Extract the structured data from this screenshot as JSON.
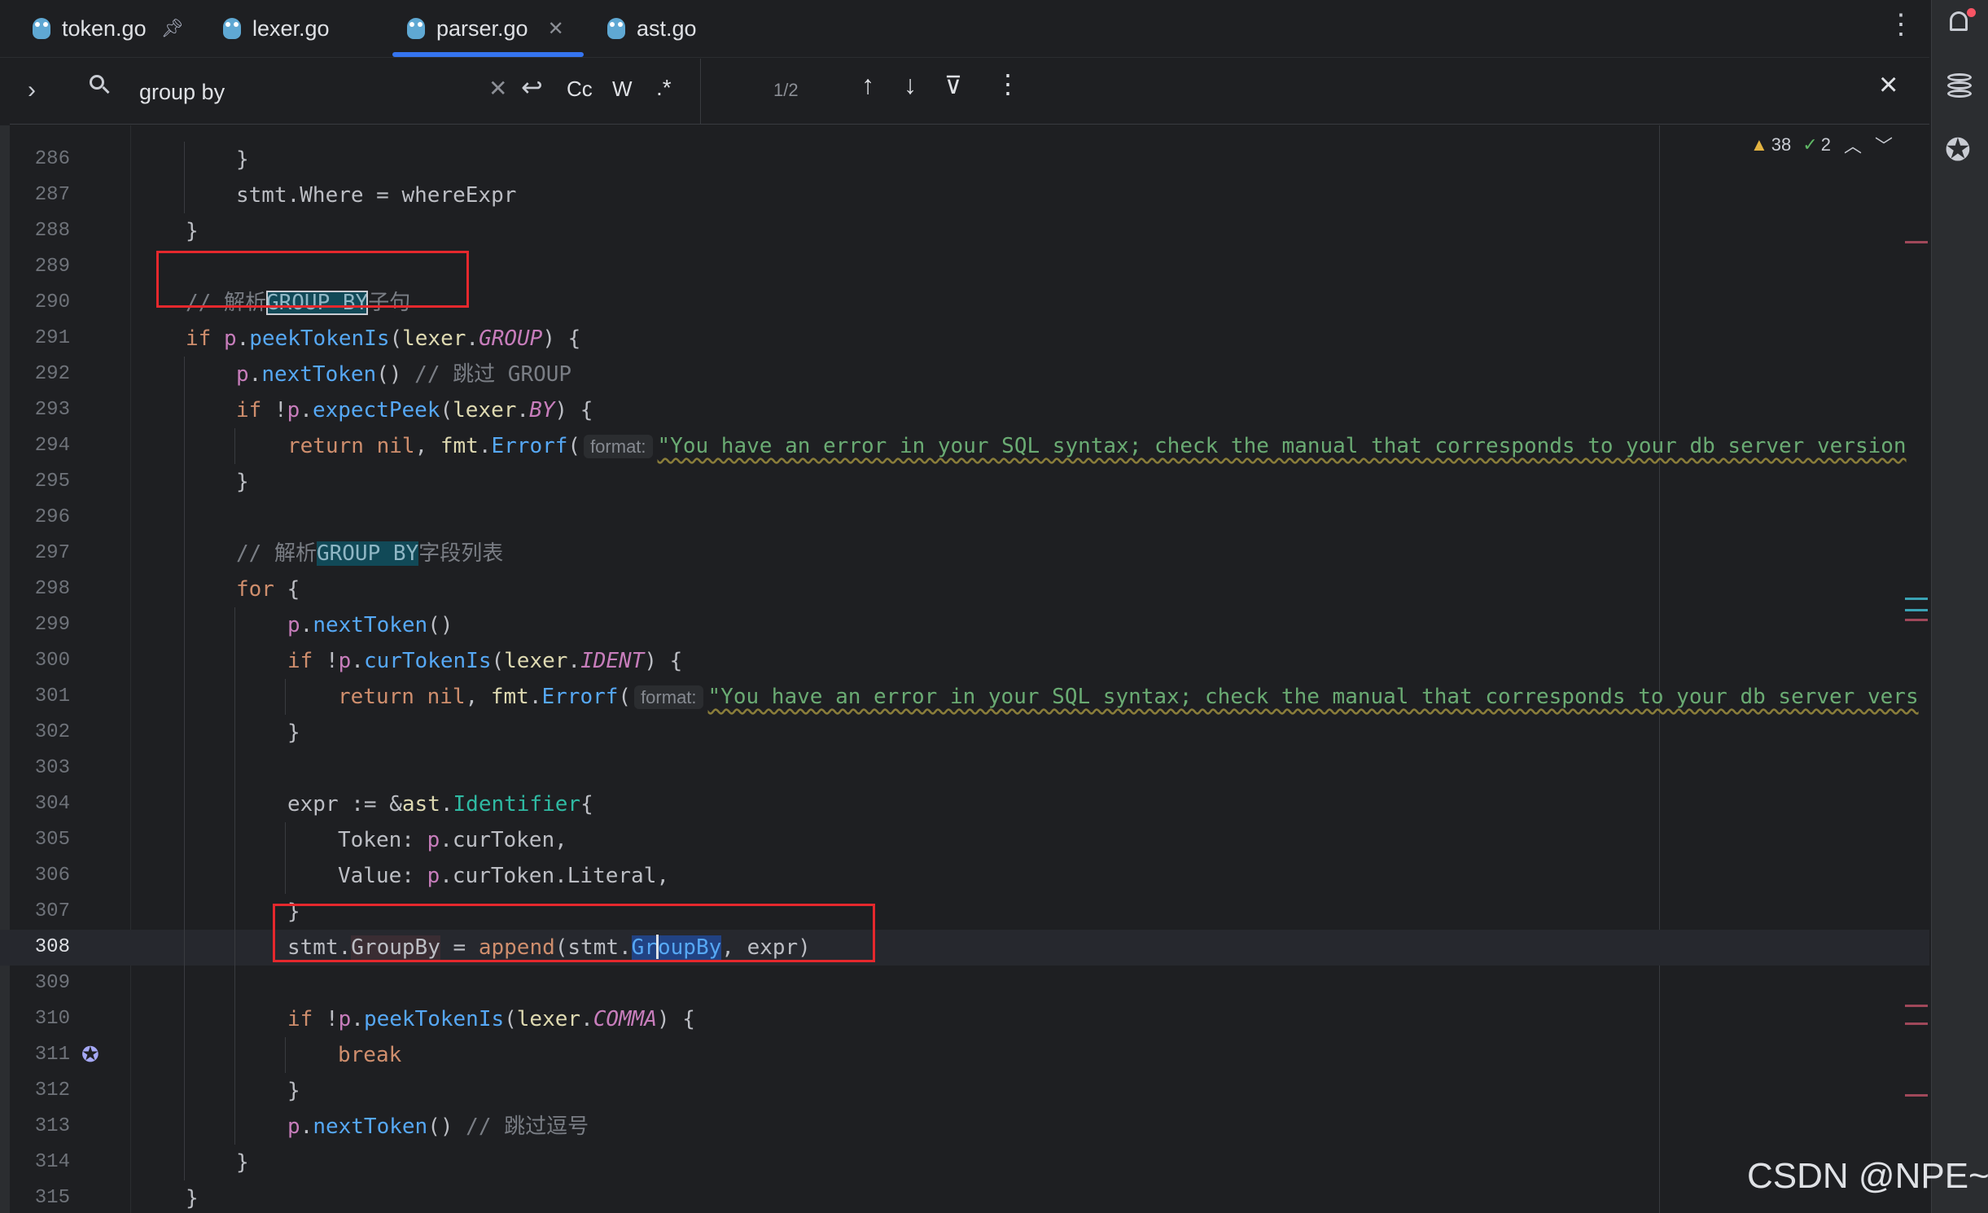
{
  "tabs": [
    {
      "label": "token.go",
      "pinned": true
    },
    {
      "label": "lexer.go"
    },
    {
      "label": "parser.go",
      "active": true
    },
    {
      "label": "ast.go"
    }
  ],
  "find": {
    "query": "group by",
    "match_case": "Cc",
    "words": "W",
    "regex": ".*",
    "count": "1/2"
  },
  "inspections": {
    "warnings": "38",
    "ok": "2"
  },
  "code": {
    "inlay_hint": "format:",
    "error_msg_1": "\"You have an error in your SQL syntax; check the manual that corresponds to your db server version",
    "error_msg_2": "\"You have an error in your SQL syntax; check the manual that corresponds to your db server vers",
    "comment_parse": "// 解析",
    "group_by": "GROUP BY",
    "clause_suffix": "子句",
    "fields_suffix": "字段列表",
    "skip_group": "// 跳过 GROUP",
    "skip_comma": "// 跳过逗号"
  },
  "watermark": "CSDN @NPE~",
  "colors": {
    "accent": "#3574f0",
    "annotation": "#e5282d",
    "match_highlight": "#114957"
  }
}
